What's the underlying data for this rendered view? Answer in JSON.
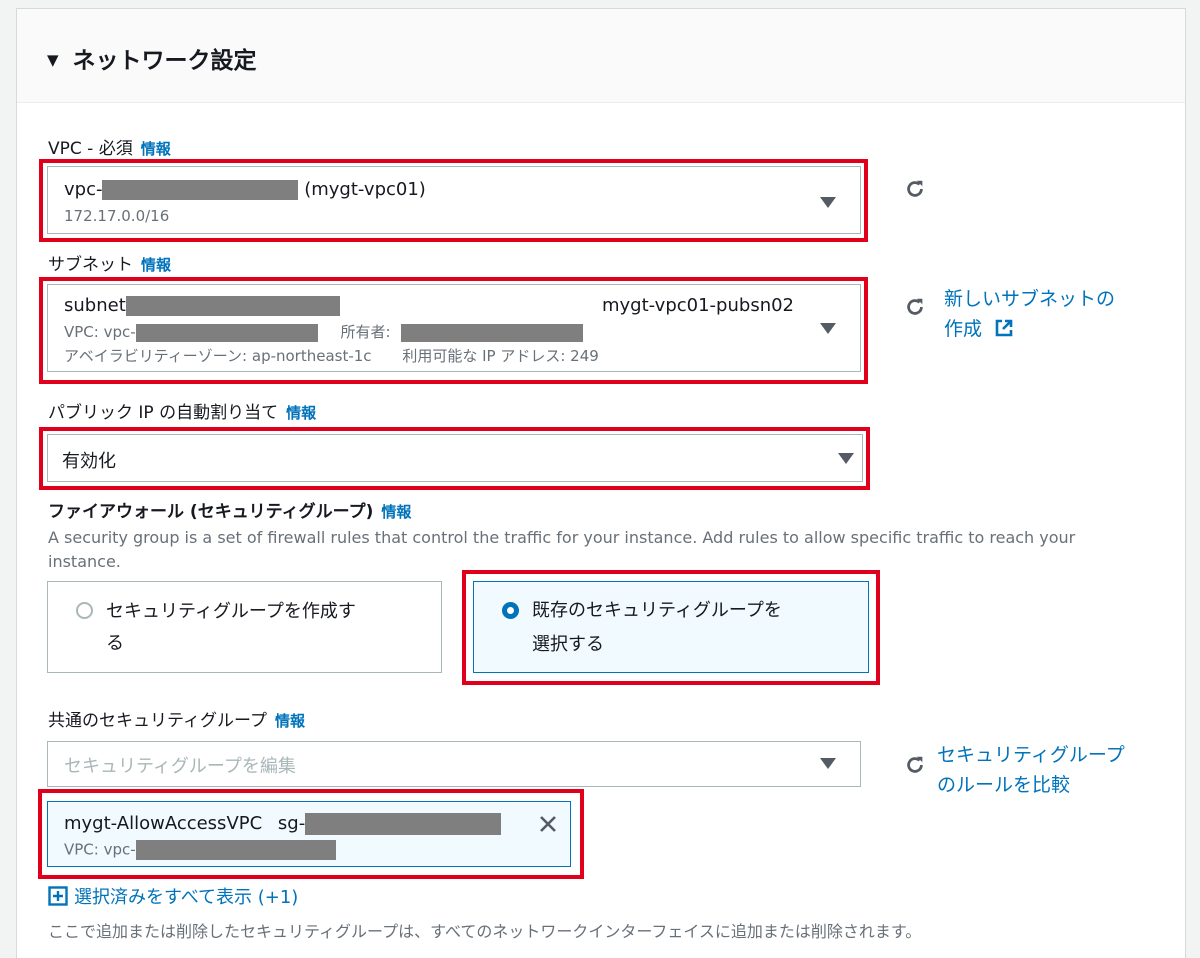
{
  "section": {
    "title": "ネットワーク設定",
    "toggle": "▼"
  },
  "vpc": {
    "label": "VPC - 必須",
    "info": "情報",
    "value_prefix": "vpc-",
    "value_suffix": "(mygt-vpc01)",
    "cidr": "172.17.0.0/16"
  },
  "subnet": {
    "label": "サブネット",
    "info": "情報",
    "value_prefix": "subnet",
    "name": "mygt-vpc01-pubsn02",
    "vpc_prefix": "VPC: vpc-",
    "owner_label": "所有者:",
    "az": "アベイラビリティーゾーン: ap-northeast-1c",
    "available_ip": "利用可能な IP アドレス: 249",
    "create_link_line1": "新しいサブネットの",
    "create_link_line2": "作成"
  },
  "public_ip": {
    "label": "パブリック IP の自動割り当て",
    "info": "情報",
    "value": "有効化"
  },
  "firewall": {
    "label": "ファイアウォール (セキュリティグループ)",
    "info": "情報",
    "description": "A security group is a set of firewall rules that control the traffic for your instance. Add rules to allow specific traffic to reach your instance.",
    "option_create_line1": "セキュリティグループを作成す",
    "option_create_line2": "る",
    "option_existing_line1": "既存のセキュリティグループを",
    "option_existing_line2": "選択する",
    "selected_option": "existing"
  },
  "common_sg": {
    "label": "共通のセキュリティグループ",
    "info": "情報",
    "placeholder": "セキュリティグループを編集",
    "compare_link_line1": "セキュリティグループ",
    "compare_link_line2": "のルールを比較",
    "token_name": "mygt-AllowAccessVPC",
    "token_id_prefix": "sg-",
    "token_vpc_prefix": "VPC: vpc-",
    "show_all": "選択済みをすべて表示 (+1)",
    "note": "ここで追加または削除したセキュリティグループは、すべてのネットワークインターフェイスに追加または削除されます。"
  },
  "colors": {
    "highlight": "#e0001b",
    "link": "#0073bb",
    "redaction": "#7f7f7f"
  }
}
